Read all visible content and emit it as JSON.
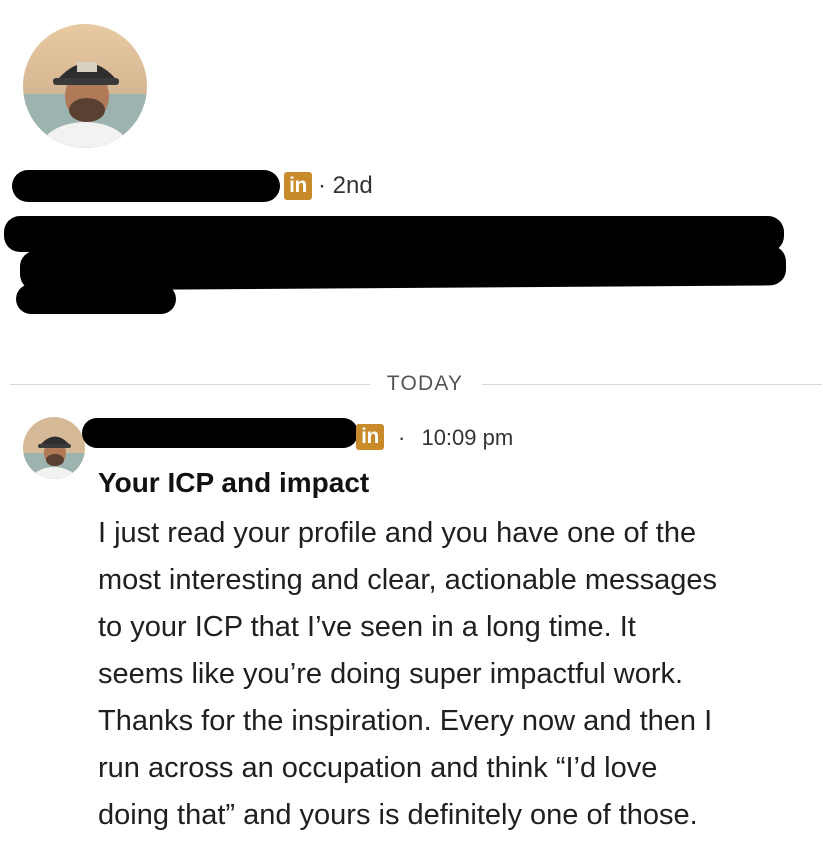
{
  "profile": {
    "connection_degree": "2nd",
    "linkedin_badge": "in"
  },
  "thread": {
    "day_divider": "TODAY"
  },
  "message": {
    "linkedin_badge": "in",
    "separator": "·",
    "timestamp": "10:09 pm",
    "subject": "Your ICP and impact",
    "body_lines": [
      "I just read your profile and you have one of the",
      "most interesting and clear, actionable messages",
      "to your ICP that I’ve seen in a long time. It",
      "seems like you’re doing super impactful work.",
      "Thanks for the inspiration.  Every now and then I",
      "run across an occupation and think “I’d love",
      "doing that” and yours is definitely one of those."
    ]
  },
  "icons": {
    "linkedin": "linkedin-icon",
    "avatar": "avatar-photo"
  },
  "colors": {
    "linkedin_badge": "#c98a2a",
    "redaction": "#000000"
  }
}
